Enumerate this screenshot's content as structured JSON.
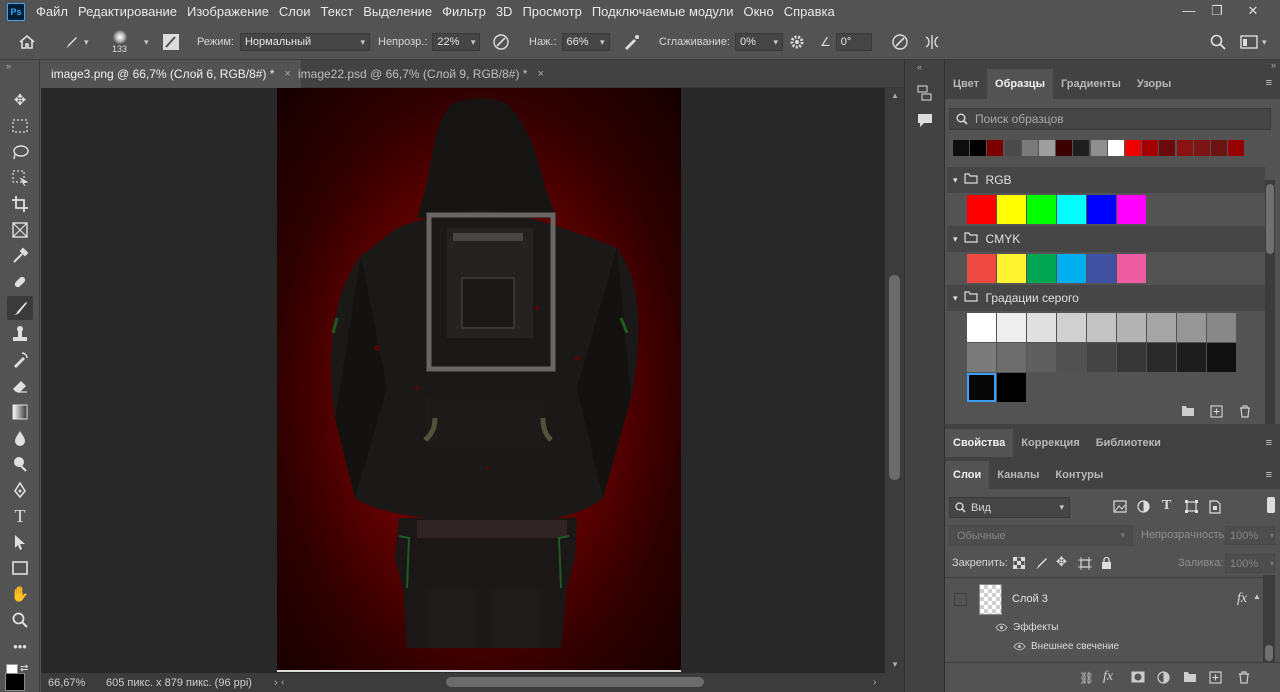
{
  "app": {
    "logo": "Ps"
  },
  "menu": [
    "Файл",
    "Редактирование",
    "Изображение",
    "Слои",
    "Текст",
    "Выделение",
    "Фильтр",
    "3D",
    "Просмотр",
    "Подключаемые модули",
    "Окно",
    "Справка"
  ],
  "window_controls": {
    "minimize": "—",
    "restore": "❐",
    "close": "✕"
  },
  "options": {
    "brush_size": "133",
    "mode_label": "Режим:",
    "mode_value": "Нормальный",
    "opacity_label": "Непрозр.:",
    "opacity_value": "22%",
    "pressure_label": "Наж.:",
    "pressure_value": "66%",
    "smoothing_label": "Сглаживание:",
    "smoothing_value": "0%",
    "angle_value": "0°"
  },
  "tabs": [
    {
      "label": "image3.png @ 66,7% (Слой 6, RGB/8#) *",
      "close": "×"
    },
    {
      "label": "image22.psd @ 66,7% (Слой 9, RGB/8#) *",
      "close": "×"
    }
  ],
  "status": {
    "zoom": "66,67%",
    "doc_info": "605 пикс. x 879 пикс. (96 ppi)",
    "arrow": "›"
  },
  "swatches_panel": {
    "tabs": [
      "Цвет",
      "Образцы",
      "Градиенты",
      "Узоры"
    ],
    "active_tab": "Образцы",
    "search_placeholder": "Поиск образцов",
    "recent": [
      "#0e0e0e",
      "#000000",
      "#7d0000",
      "#4a4a4a",
      "#7a7a7a",
      "#9e9e9e",
      "#3a0000",
      "#1e1e1e",
      "#8f8f8f",
      "#ffffff",
      "#ee0000",
      "#a50000",
      "#6a0a0a",
      "#8a1212",
      "#7d1515",
      "#6d1313",
      "#950000"
    ],
    "groups": [
      {
        "name": "RGB",
        "colors": [
          "#ff0000",
          "#ffff00",
          "#00ff00",
          "#00ffff",
          "#0000ff",
          "#ff00ff"
        ]
      },
      {
        "name": "CMYK",
        "colors": [
          "#ee4a43",
          "#fff22e",
          "#00a651",
          "#00aeef",
          "#3f51a3",
          "#ef5ba1"
        ]
      },
      {
        "name": "Градации серого",
        "colors": [
          "#ffffff",
          "#eeeeee",
          "#e0e0e0",
          "#d0d0d0",
          "#c3c3c3",
          "#b3b3b3",
          "#a5a5a5",
          "#969696",
          "#888888",
          "#7b7b7b",
          "#6d6d6d",
          "#5f5f5f",
          "#525252",
          "#444444",
          "#373737",
          "#2a2a2a",
          "#1d1d1d",
          "#111111",
          "#070707",
          "#000000"
        ]
      }
    ]
  },
  "properties_panel": {
    "tabs": [
      "Свойства",
      "Коррекция",
      "Библиотеки"
    ]
  },
  "layers_panel": {
    "tabs": [
      "Слои",
      "Каналы",
      "Контуры"
    ],
    "filter_label": "Вид",
    "blend_mode": "Обычные",
    "opacity_label": "Непрозрачность:",
    "opacity_value": "100%",
    "lock_label": "Закрепить:",
    "fill_label": "Заливка:",
    "fill_value": "100%",
    "layer_name": "Слой 3",
    "fx": "fx",
    "effects_label": "Эффекты",
    "effect_name": "Внешнее свечение"
  }
}
